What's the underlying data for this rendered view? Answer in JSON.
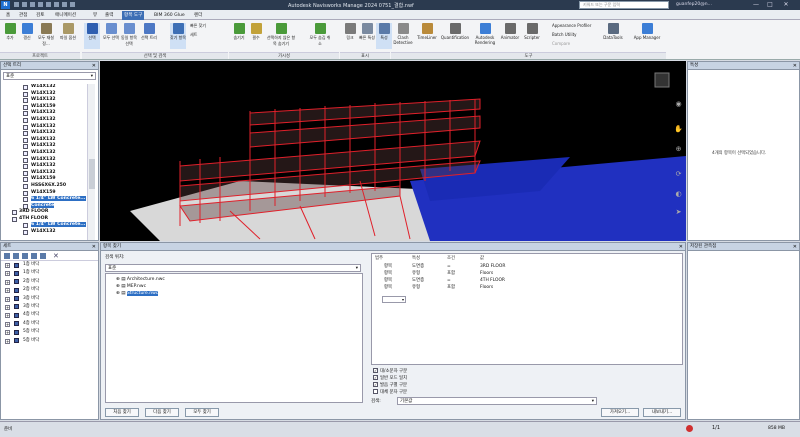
{
  "window": {
    "title": "Autodesk Navisworks Manage 2024    0751_결합.nwf",
    "search_placeholder": "키워드 또는 구문 입력",
    "user": "guanfep20@n...",
    "min": "—",
    "max": "□",
    "close": "✕",
    "logo": "N"
  },
  "tabs": [
    "홈",
    "관점",
    "검토",
    "애니메이션",
    "뷰",
    "출력",
    "항목 도구",
    "BIM 360 Glue",
    "렌더"
  ],
  "active_tab_index": 6,
  "ribbon": {
    "groups": [
      {
        "label": "프로젝트"
      },
      {
        "label": "선택 및 검색"
      },
      {
        "label": "가시성"
      },
      {
        "label": "표시"
      },
      {
        "label": "도구"
      }
    ],
    "buttons": [
      "추가",
      "갱신",
      "모두 재설정...",
      "파일 옵션",
      "선택",
      "모두 선택",
      "동일 항목 선택",
      "선택 트리",
      "찾기 항목",
      "숨기기",
      "필수",
      "선택하지 않은 항목 숨기기",
      "모두 숨김 취소",
      "링크",
      "빠른 특성",
      "특성",
      "Clash Detective",
      "TimeLiner",
      "Quantification",
      "Autodesk Rendering",
      "Animator",
      "Scripter",
      "DataTools",
      "App Manager"
    ],
    "small_items": [
      "빠른 찾기",
      "세트",
      "Appearance Profiler",
      "Batch Utility",
      "Compare"
    ]
  },
  "selection_tree": {
    "title": "선택 트리",
    "close": "✕",
    "dropdown": "표준",
    "items": [
      {
        "label": "W14X132",
        "selected": false,
        "level": 2
      },
      {
        "label": "W14X132",
        "selected": false,
        "level": 2
      },
      {
        "label": "W14X132",
        "selected": false,
        "level": 2
      },
      {
        "label": "W14X159",
        "selected": false,
        "level": 2
      },
      {
        "label": "W14X132",
        "selected": false,
        "level": 2
      },
      {
        "label": "W14X132",
        "selected": false,
        "level": 2
      },
      {
        "label": "W14X132",
        "selected": false,
        "level": 2
      },
      {
        "label": "W14X132",
        "selected": false,
        "level": 2
      },
      {
        "label": "W14X132",
        "selected": false,
        "level": 2
      },
      {
        "label": "W14X132",
        "selected": false,
        "level": 2
      },
      {
        "label": "W14X132",
        "selected": false,
        "level": 2
      },
      {
        "label": "W14X132",
        "selected": false,
        "level": 2
      },
      {
        "label": "W14X132",
        "selected": false,
        "level": 2
      },
      {
        "label": "W14X132",
        "selected": false,
        "level": 2
      },
      {
        "label": "W14X159",
        "selected": false,
        "level": 2
      },
      {
        "label": "HSS6X6X.250",
        "selected": false,
        "level": 2
      },
      {
        "label": "W14X159",
        "selected": false,
        "level": 2
      },
      {
        "label": "6 1/4\" LW Concrete...",
        "selected": true,
        "level": 2
      },
      {
        "label": "Concrete",
        "selected": true,
        "level": 2
      },
      {
        "label": "3RD FLOOR",
        "selected": false,
        "level": 1
      },
      {
        "label": "4TH FLOOR",
        "selected": false,
        "level": 1
      },
      {
        "label": "6 1/4\" LW Concrete...",
        "selected": true,
        "level": 2
      },
      {
        "label": "W14X132",
        "selected": false,
        "level": 2
      }
    ]
  },
  "properties": {
    "title": "특성",
    "close": "✕",
    "empty_message": "4개의 항목이 선택되었습니다."
  },
  "sets": {
    "title": "세트",
    "close": "✕",
    "items": [
      "1층 바닥",
      "1층 바닥",
      "2층 바닥",
      "2층 바닥",
      "3층 바닥",
      "3층 바닥",
      "4층 바닥",
      "4층 바닥",
      "5층 바닥",
      "5층 바닥"
    ]
  },
  "find_items": {
    "title": "항목 찾기",
    "close": "✕",
    "search_label": "검색 위치:",
    "dropdown": "표준",
    "files": [
      {
        "label": "Architecture.nwc",
        "selected": false
      },
      {
        "label": "MEP.nwc",
        "selected": false
      },
      {
        "label": "Structure.nwc",
        "selected": true
      }
    ],
    "columns": [
      "범주",
      "특성",
      "조건",
      "값"
    ],
    "rows": [
      {
        "cat": "항목",
        "prop": "도면층",
        "cond": "=",
        "val": "3RD FLOOR"
      },
      {
        "cat": "항목",
        "prop": "유형",
        "cond": "포함",
        "val": "Floors"
      },
      {
        "cat": "항목",
        "prop": "도면층",
        "cond": "=",
        "val": "4TH FLOOR"
      },
      {
        "cat": "항목",
        "prop": "유형",
        "cond": "포함",
        "val": "Floors"
      }
    ],
    "checkboxes": [
      {
        "label": "대/소문자 구분",
        "checked": true
      },
      {
        "label": "일반 모드 일치",
        "checked": true
      },
      {
        "label": "발음 구별 구분",
        "checked": true
      },
      {
        "label": "대체 문자 구분",
        "checked": false
      }
    ],
    "search_mode_label": "검색:",
    "search_mode": "기본값",
    "btn_first": "처음 찾기",
    "btn_next": "다음 찾기",
    "btn_all": "모두 찾기",
    "btn_import": "가져오기...",
    "btn_export": "내보내기..."
  },
  "props_panel": {
    "title": "저장된 관측점",
    "close": "✕"
  },
  "status": {
    "left": "준비",
    "right": "858 MB",
    "page": "1/1"
  },
  "colors": {
    "accent": "#3d6fb5",
    "selection": "#2d6fc4",
    "structure_red": "#e0202a",
    "floor_blue": "#1f2fbf"
  }
}
